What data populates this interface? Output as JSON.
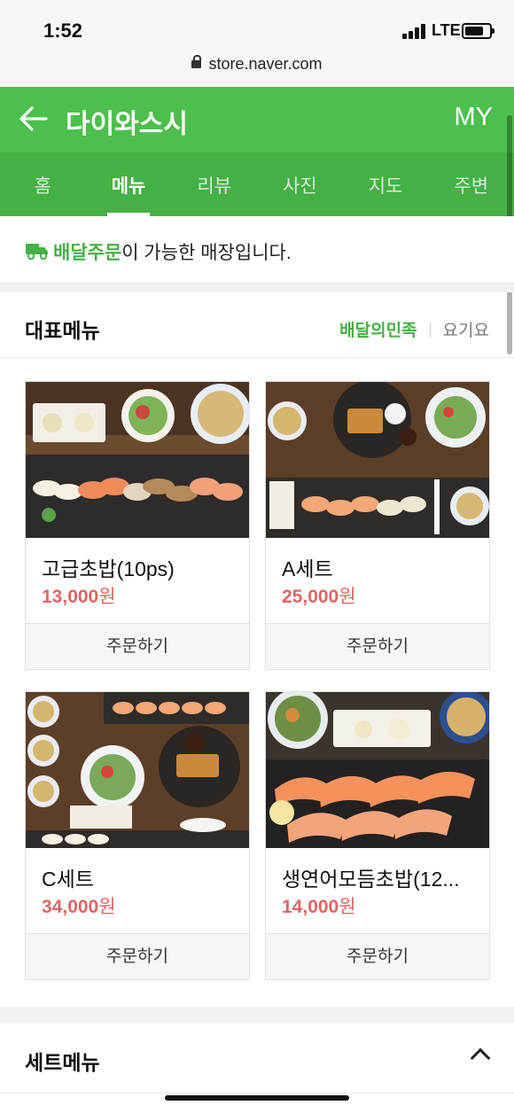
{
  "status_bar": {
    "time": "1:52",
    "network": "LTE",
    "url": "store.naver.com"
  },
  "header": {
    "title": "다이와스시",
    "my_label": "MY"
  },
  "tabs": [
    {
      "label": "홈",
      "active": false
    },
    {
      "label": "메뉴",
      "active": true
    },
    {
      "label": "리뷰",
      "active": false
    },
    {
      "label": "사진",
      "active": false
    },
    {
      "label": "지도",
      "active": false
    },
    {
      "label": "주변",
      "active": false
    }
  ],
  "notice": {
    "highlight": "배달주문",
    "rest": "이 가능한 매장입니다."
  },
  "featured": {
    "title": "대표메뉴",
    "links": [
      "배달의민족",
      "요기요"
    ]
  },
  "menu_items": [
    {
      "name": "고급초밥(10ps)",
      "price": "13,000",
      "currency": "원",
      "order_label": "주문하기"
    },
    {
      "name": "A세트",
      "price": "25,000",
      "currency": "원",
      "order_label": "주문하기"
    },
    {
      "name": "C세트",
      "price": "34,000",
      "currency": "원",
      "order_label": "주문하기"
    },
    {
      "name": "생연어모듬초밥(12...",
      "price": "14,000",
      "currency": "원",
      "order_label": "주문하기"
    }
  ],
  "set_menu": {
    "title": "세트메뉴"
  },
  "colors": {
    "brand_green": "#4cbf4c",
    "tab_green": "#45b045",
    "price_red": "#e06464"
  }
}
